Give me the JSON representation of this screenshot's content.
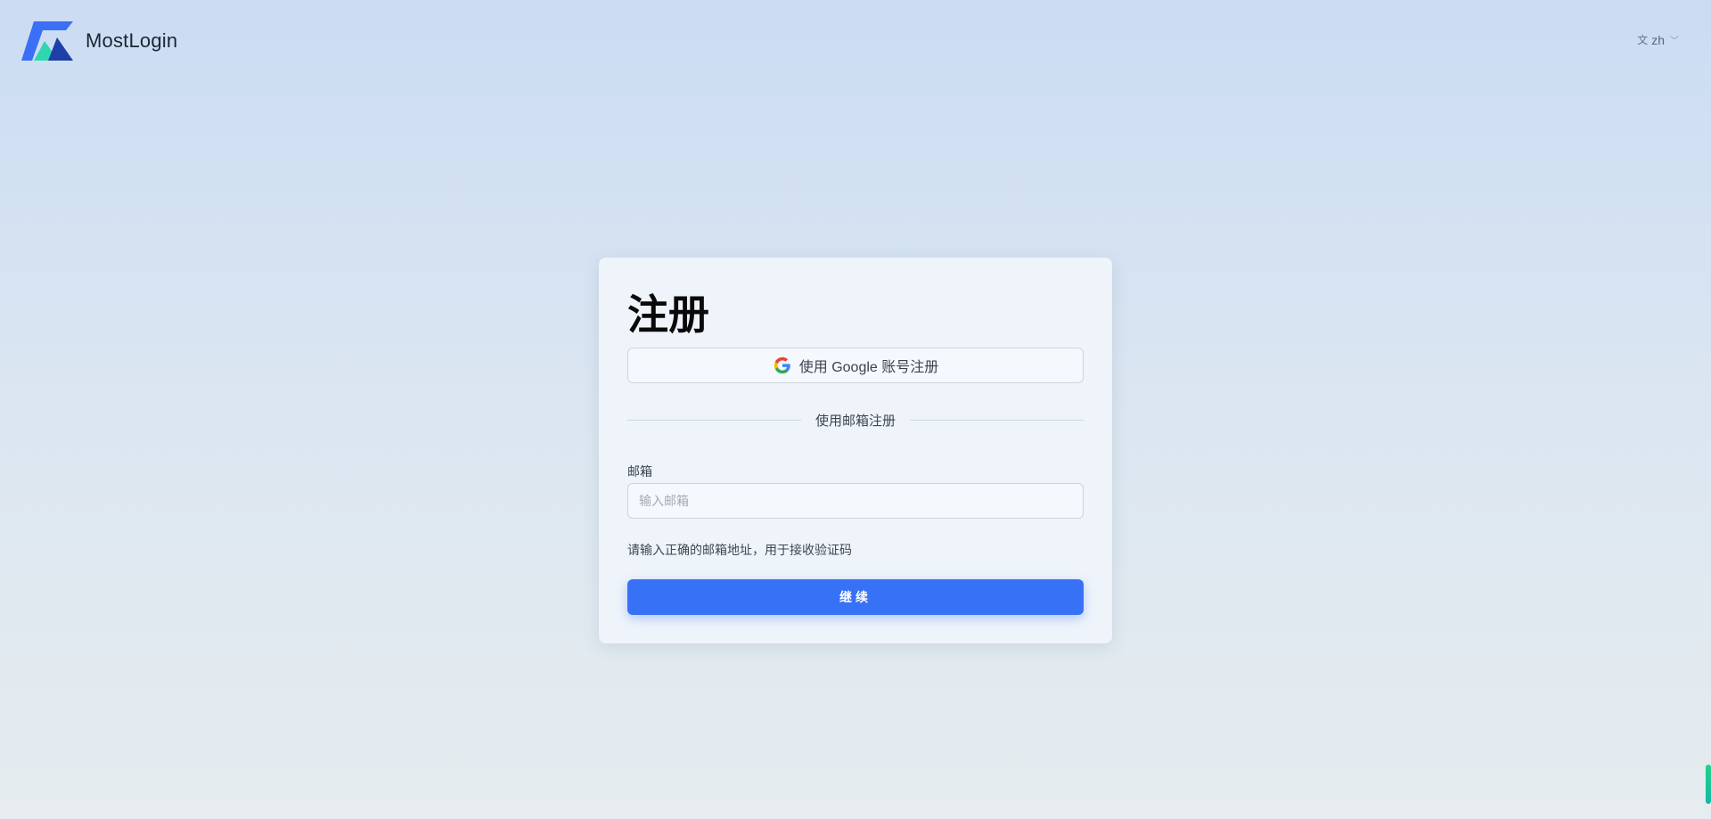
{
  "header": {
    "brand": "MostLogin",
    "language": "zh",
    "language_icon": "translate-icon",
    "chevron_icon": "chevron-down-icon"
  },
  "signup": {
    "title": "注册",
    "google_button": "使用 Google 账号注册",
    "divider_text": "使用邮箱注册",
    "email_label": "邮箱",
    "email_value": "",
    "email_placeholder": "输入邮箱",
    "hint": "请输入正确的邮箱地址，用于接收验证码",
    "continue_button": "继续"
  },
  "colors": {
    "primary": "#3772f6",
    "logo_blue": "#3b6ff5",
    "logo_teal": "#2fd7b0",
    "logo_navy": "#1e3fa8"
  }
}
